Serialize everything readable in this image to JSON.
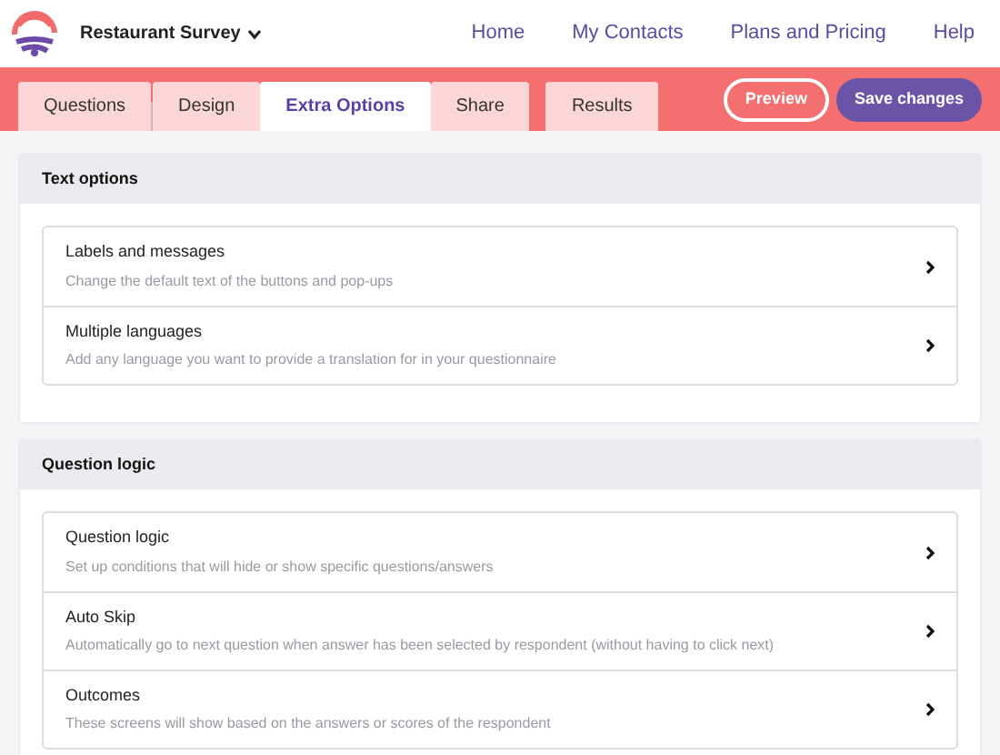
{
  "survey": {
    "title": "Restaurant Survey"
  },
  "nav": [
    "Home",
    "My Contacts",
    "Plans and Pricing",
    "Help"
  ],
  "tabs": [
    {
      "label": "Questions",
      "selected": false
    },
    {
      "label": "Design",
      "selected": false
    },
    {
      "label": "Extra Options",
      "selected": true
    },
    {
      "label": "Share",
      "selected": false
    }
  ],
  "results_tab": {
    "label": "Results",
    "selected": false
  },
  "actions": {
    "preview": "Preview",
    "save": "Save changes"
  },
  "sections": [
    {
      "title": "Text options",
      "items": [
        {
          "title": "Labels and messages",
          "description": "Change the default text of the buttons and pop-ups"
        },
        {
          "title": "Multiple languages",
          "description": "Add any language you want to provide a translation for in your questionnaire"
        }
      ]
    },
    {
      "title": "Question logic",
      "items": [
        {
          "title": "Question logic",
          "description": "Set up conditions that will hide or show specific questions/answers"
        },
        {
          "title": "Auto Skip",
          "description": "Automatically go to next question when answer has been selected by respondent (without having to click next)"
        },
        {
          "title": "Outcomes",
          "description": "These screens will show based on the answers or scores of the respondent"
        }
      ]
    }
  ]
}
